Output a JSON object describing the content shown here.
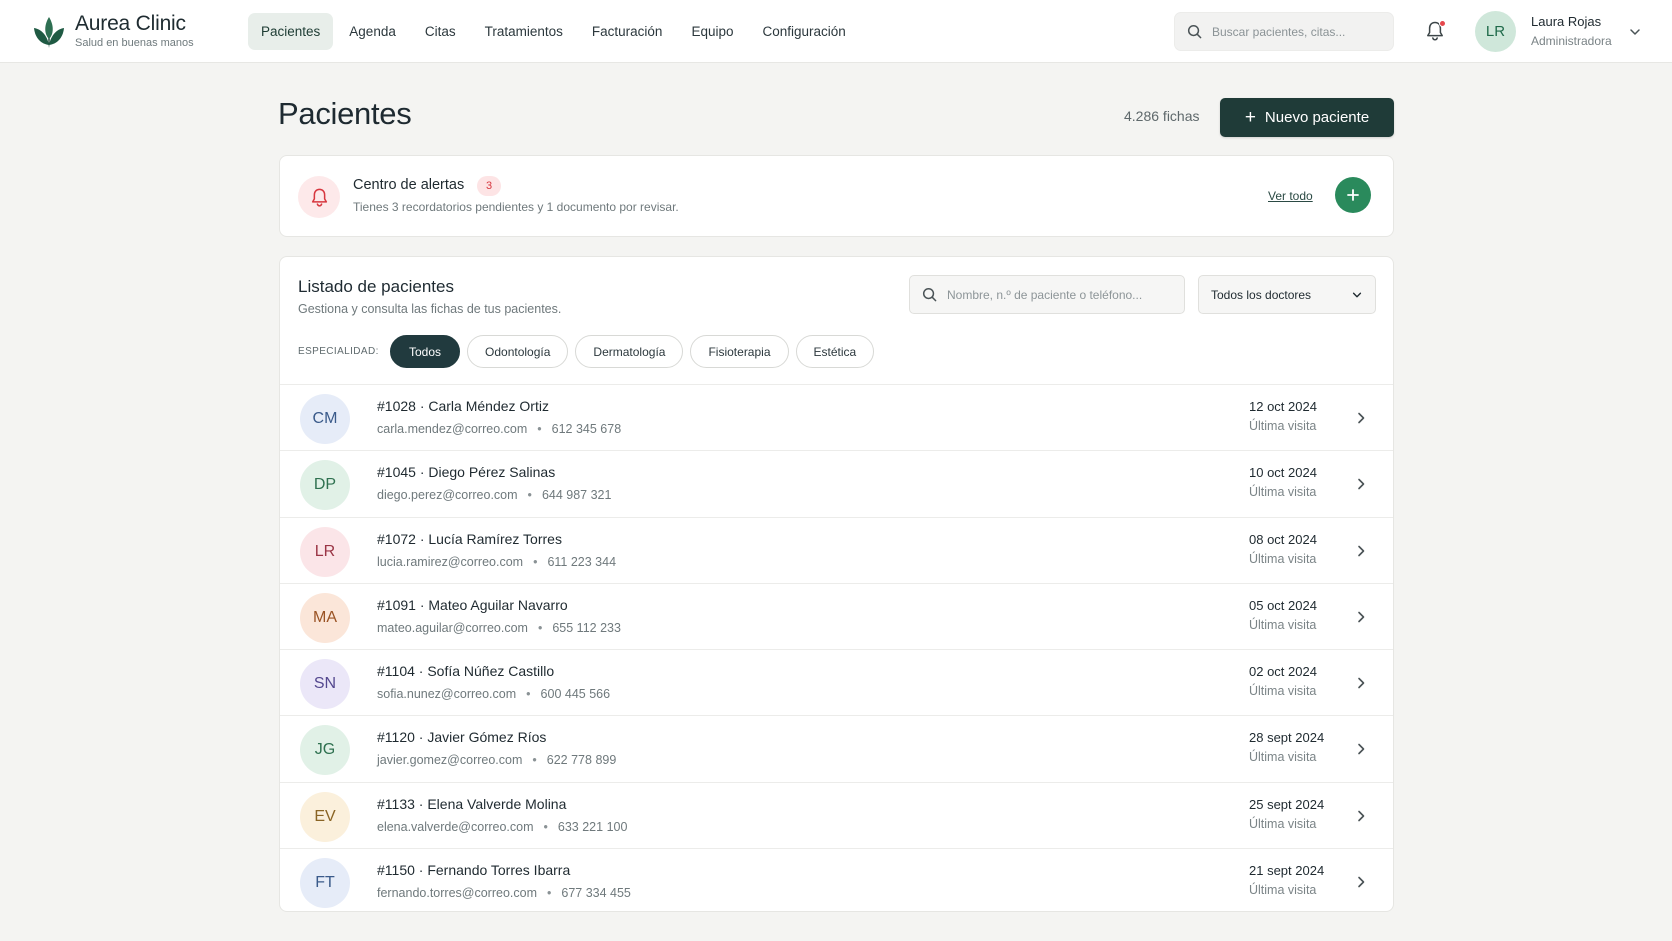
{
  "brand": {
    "name": "Aurea Clinic",
    "tagline": "Salud en buenas manos"
  },
  "nav": {
    "items": [
      {
        "label": "Pacientes",
        "active": true
      },
      {
        "label": "Agenda"
      },
      {
        "label": "Citas"
      },
      {
        "label": "Tratamientos"
      },
      {
        "label": "Facturación"
      },
      {
        "label": "Equipo"
      },
      {
        "label": "Configuración"
      }
    ]
  },
  "top_search": {
    "placeholder": "Buscar pacientes, citas..."
  },
  "user": {
    "initials": "LR",
    "name": "Laura Rojas",
    "role": "Administradora"
  },
  "page": {
    "title": "Pacientes",
    "count": "4.286 fichas",
    "new_button": "Nuevo paciente"
  },
  "alerts": {
    "title": "Centro de alertas",
    "badge": "3",
    "description": "Tienes 3 recordatorios pendientes y 1 documento por revisar.",
    "link": "Ver todo"
  },
  "list": {
    "title": "Listado de pacientes",
    "subtitle": "Gestiona y consulta las fichas de tus pacientes.",
    "search_placeholder": "Nombre, n.º de paciente o teléfono...",
    "doctor_filter": "Todos los doctores",
    "specialty_label": "ESPECIALIDAD:",
    "chips": [
      {
        "label": "Todos",
        "active": true
      },
      {
        "label": "Odontología"
      },
      {
        "label": "Dermatología"
      },
      {
        "label": "Fisioterapia"
      },
      {
        "label": "Estética"
      }
    ],
    "last_visit_label": "Última visita",
    "patients": [
      {
        "initials": "CM",
        "title": "#1028 · Carla Méndez Ortiz",
        "email": "carla.mendez@correo.com",
        "phone": "612 345 678",
        "date": "12 oct 2024",
        "avatar_bg": "#e6ecf8",
        "avatar_fg": "#3a5a8a"
      },
      {
        "initials": "DP",
        "title": "#1045 · Diego Pérez Salinas",
        "email": "diego.perez@correo.com",
        "phone": "644 987 321",
        "date": "10 oct 2024",
        "avatar_bg": "#e1f1e7",
        "avatar_fg": "#2f7150"
      },
      {
        "initials": "LR",
        "title": "#1072 · Lucía Ramírez Torres",
        "email": "lucia.ramirez@correo.com",
        "phone": "611 223 344",
        "date": "08 oct 2024",
        "avatar_bg": "#fbe5e8",
        "avatar_fg": "#9a3545"
      },
      {
        "initials": "MA",
        "title": "#1091 · Mateo Aguilar Navarro",
        "email": "mateo.aguilar@correo.com",
        "phone": "655 112 233",
        "date": "05 oct 2024",
        "avatar_bg": "#fbe6d9",
        "avatar_fg": "#9a5324"
      },
      {
        "initials": "SN",
        "title": "#1104 · Sofía Núñez Castillo",
        "email": "sofia.nunez@correo.com",
        "phone": "600 445 566",
        "date": "02 oct 2024",
        "avatar_bg": "#ebe7f8",
        "avatar_fg": "#54488f"
      },
      {
        "initials": "JG",
        "title": "#1120 · Javier Gómez Ríos",
        "email": "javier.gomez@correo.com",
        "phone": "622 778 899",
        "date": "28 sept 2024",
        "avatar_bg": "#e1f1e7",
        "avatar_fg": "#2f7150"
      },
      {
        "initials": "EV",
        "title": "#1133 · Elena Valverde Molina",
        "email": "elena.valverde@correo.com",
        "phone": "633 221 100",
        "date": "25 sept 2024",
        "avatar_bg": "#fbf0dc",
        "avatar_fg": "#8a6424"
      },
      {
        "initials": "FT",
        "title": "#1150 · Fernando Torres Ibarra",
        "email": "fernando.torres@correo.com",
        "phone": "677 334 455",
        "date": "21 sept 2024",
        "avatar_bg": "#e6ecf8",
        "avatar_fg": "#3a5a8a"
      }
    ]
  },
  "colors": {
    "accent_dark": "#1f3b38",
    "accent_green": "#2a8a5c",
    "alert_red": "#d7373f",
    "background": "#f4f4f2"
  },
  "icons": [
    "logo-leaf-icon",
    "search-icon",
    "bell-icon",
    "chevron-down-icon",
    "plus-icon",
    "chevron-right-icon"
  ]
}
